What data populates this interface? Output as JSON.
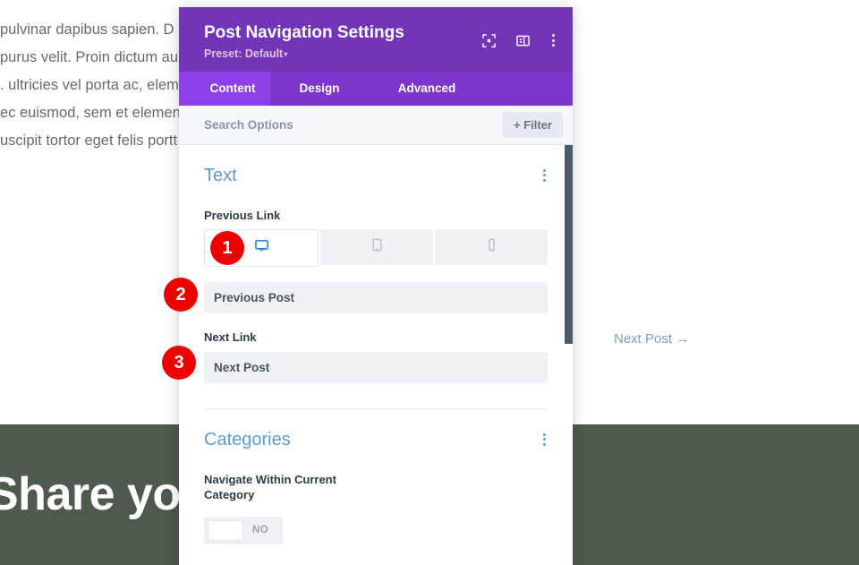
{
  "page_background": {
    "article_lines": [
      " pulvinar dapibus sapien. D",
      "purus velit. Proin dictum au",
      ". ultricies vel porta ac, eleme",
      "ec euismod, sem et element",
      "uscipit tortor eget felis portt"
    ],
    "next_post_link": "Next Post →",
    "green_heading": "Share you",
    "green_band_color": "#4e5a4e"
  },
  "modal": {
    "title": "Post Navigation Settings",
    "preset_label": "Preset: Default",
    "preset_caret": "▾",
    "header_color": "#7335b8",
    "header_icons": [
      {
        "name": "focus-icon"
      },
      {
        "name": "layout-panel-icon"
      },
      {
        "name": "overflow-menu-icon"
      }
    ],
    "tabs": [
      {
        "label": "Content",
        "active": true
      },
      {
        "label": "Design",
        "active": false
      },
      {
        "label": "Advanced",
        "active": false
      }
    ],
    "active_tab_color": "#8d3fe8",
    "search": {
      "placeholder": "Search Options",
      "value": ""
    },
    "filter_button": "+ Filter",
    "sections": [
      {
        "id": "text",
        "title": "Text",
        "title_color": "#5b9bd5",
        "fields": [
          {
            "label": "Previous Link",
            "device_tabs": [
              {
                "icon": "desktop-icon",
                "active": true
              },
              {
                "icon": "tablet-icon",
                "active": false
              },
              {
                "icon": "phone-icon",
                "active": false
              }
            ],
            "input_value": "Previous Post"
          },
          {
            "label": "Next Link",
            "input_value": "Next Post"
          }
        ]
      },
      {
        "id": "categories",
        "title": "Categories",
        "title_color": "#5b9bd5",
        "toggle": {
          "label": "Navigate Within Current Category",
          "state_text": "NO",
          "on": false
        }
      }
    ]
  },
  "step_badges": [
    {
      "number": "1"
    },
    {
      "number": "2"
    },
    {
      "number": "3"
    }
  ]
}
